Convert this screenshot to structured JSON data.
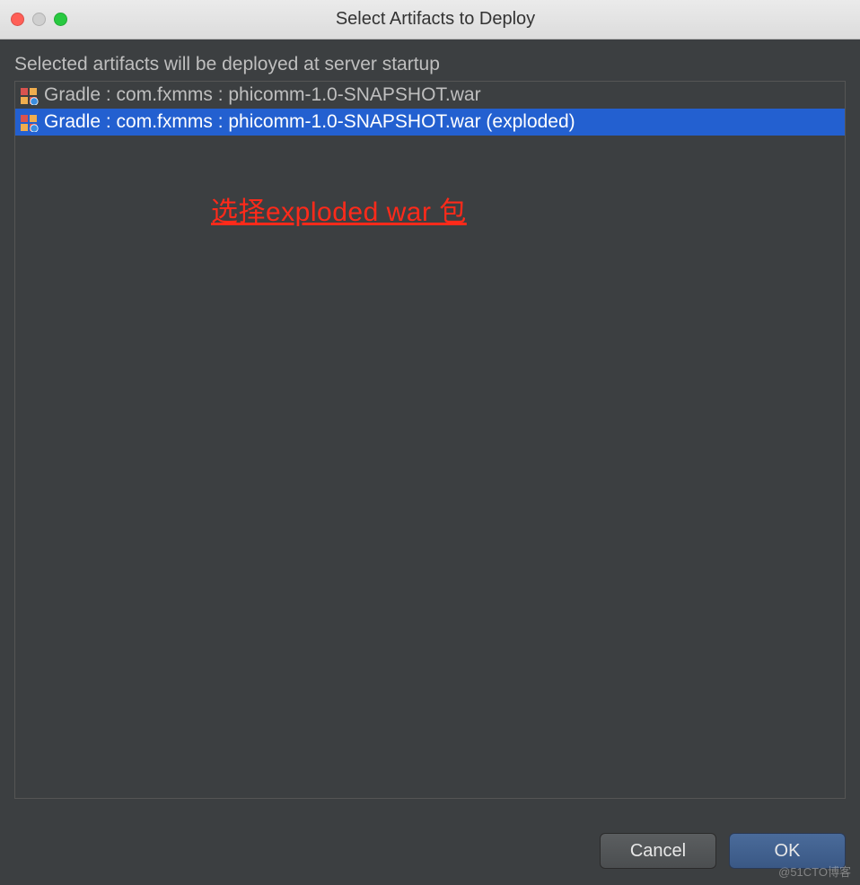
{
  "titlebar": {
    "title": "Select Artifacts to Deploy"
  },
  "subtitle": "Selected artifacts will be deployed at server startup",
  "artifacts": [
    {
      "label": "Gradle : com.fxmms : phicomm-1.0-SNAPSHOT.war",
      "selected": false
    },
    {
      "label": "Gradle : com.fxmms : phicomm-1.0-SNAPSHOT.war (exploded)",
      "selected": true
    }
  ],
  "annotation": "选择exploded war 包",
  "buttons": {
    "cancel": "Cancel",
    "ok": "OK"
  },
  "watermark": "@51CTO博客"
}
